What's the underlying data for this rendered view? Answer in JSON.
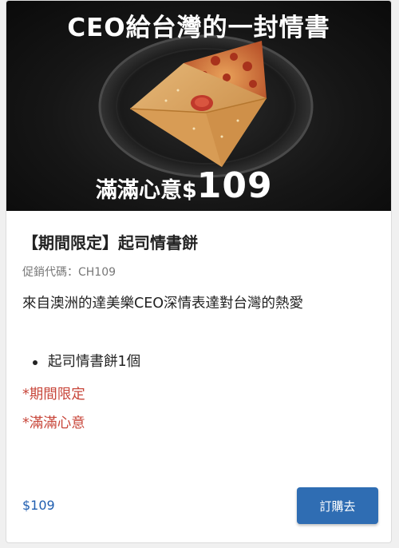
{
  "banner": {
    "headline": "CEO給台灣的一封情書",
    "price_label": "滿滿心意",
    "price_currency": "$",
    "price_amount": "109",
    "image_subject": "pizza-envelope-on-dark-plate"
  },
  "product": {
    "title": "【期間限定】起司情書餅",
    "promo_code": "促銷代碼：CH109",
    "description": "來自澳洲的達美樂CEO深情表達對台灣的熱愛",
    "items": [
      "起司情書餅1個"
    ],
    "notes": [
      "*期間限定",
      "*滿滿心意"
    ],
    "price": "$109",
    "order_button": "訂購去"
  },
  "colors": {
    "accent": "#2f6db3",
    "price_text": "#1f5eb0",
    "note_text": "#c8463a"
  }
}
